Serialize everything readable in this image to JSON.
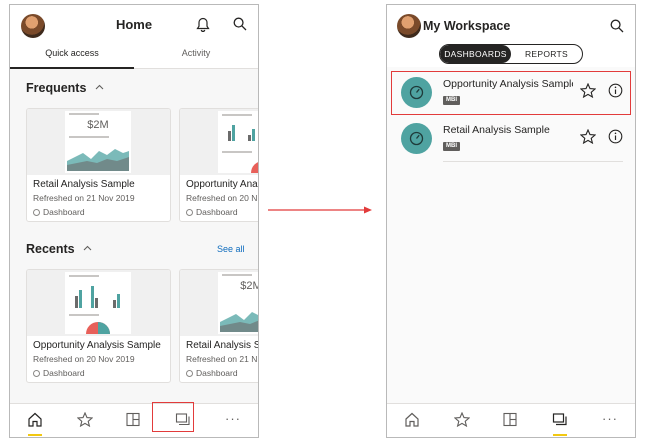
{
  "screen1": {
    "title": "Home",
    "tabs": [
      "Quick access",
      "Activity"
    ],
    "frequents": {
      "heading": "Frequents",
      "cards": [
        {
          "title": "Retail Analysis Sample",
          "subtitle": "Refreshed on 21 Nov 2019",
          "type": "Dashboard",
          "thumb_value": "$2M"
        },
        {
          "title": "Opportunity Anal",
          "subtitle": "Refreshed on 20 N",
          "type": "Dashboard"
        }
      ]
    },
    "recents": {
      "heading": "Recents",
      "see_all": "See all",
      "cards": [
        {
          "title": "Opportunity Analysis Sample",
          "subtitle": "Refreshed on 20 Nov 2019",
          "type": "Dashboard"
        },
        {
          "title": "Retail Analysis S",
          "subtitle": "Refreshed on 21 N",
          "type": "Dashboard",
          "thumb_value": "$2M"
        }
      ]
    },
    "bottom_nav": [
      "home-icon",
      "favorites-star-icon",
      "apps-icon",
      "workspaces-icon",
      "more-icon"
    ],
    "more_label": "···",
    "active_nav": "home-icon",
    "highlighted_nav": "workspaces-icon"
  },
  "screen2": {
    "title": "My Workspace",
    "segments": [
      "DASHBOARDS",
      "REPORTS"
    ],
    "active_segment": "DASHBOARDS",
    "items": [
      {
        "title": "Opportunity Analysis Sample",
        "badge": "MBI",
        "highlighted": true
      },
      {
        "title": "Retail Analysis Sample",
        "badge": "MBI",
        "highlighted": false
      }
    ],
    "bottom_nav": [
      "home-icon",
      "favorites-star-icon",
      "apps-icon",
      "workspaces-icon",
      "more-icon"
    ],
    "more_label": "···",
    "active_nav": "workspaces-icon"
  },
  "colors": {
    "highlight": "#e23b3b",
    "accent_yellow": "#f2c811",
    "dashboard_icon_teal": "#4fa3a1",
    "link_blue": "#0f6cbd"
  }
}
